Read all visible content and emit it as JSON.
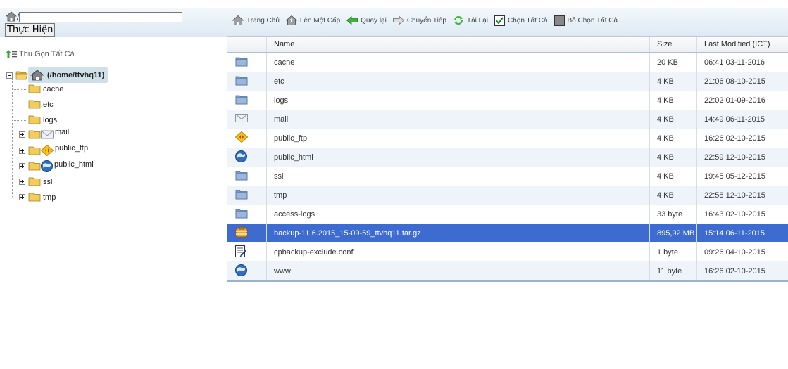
{
  "path_bar": {
    "prefix": "/",
    "value": ""
  },
  "go_button": "Thực Hiện",
  "collapse_all": "Thu Gọn Tất Cả",
  "tree": {
    "root": "(/home/ttvhq11)",
    "children": [
      {
        "label": "cache",
        "expander": "none",
        "icon": "folder-icon"
      },
      {
        "label": "etc",
        "expander": "none",
        "icon": "folder-icon"
      },
      {
        "label": "logs",
        "expander": "none",
        "icon": "folder-icon"
      },
      {
        "label": "mail",
        "expander": "plus",
        "icon": "mail-icon"
      },
      {
        "label": "public_ftp",
        "expander": "plus",
        "icon": "ftp-icon"
      },
      {
        "label": "public_html",
        "expander": "plus",
        "icon": "globe-icon"
      },
      {
        "label": "ssl",
        "expander": "plus",
        "icon": "folder-icon"
      },
      {
        "label": "tmp",
        "expander": "plus",
        "icon": "folder-icon"
      }
    ]
  },
  "toolbar": {
    "home": "Trang Chủ",
    "up": "Lên Một Cấp",
    "back": "Quay lại",
    "forward": "Chuyển Tiếp",
    "reload": "Tải Lại",
    "select_all": "Chọn Tất Cả",
    "deselect_all": "Bỏ Chọn Tất Cả"
  },
  "table": {
    "headers": {
      "icon": "",
      "name": "Name",
      "size": "Size",
      "modified": "Last Modified (ICT)"
    },
    "rows": [
      {
        "icon": "folder-icon",
        "name": "cache",
        "size": "20 KB",
        "modified": "06:41 03-11-2016"
      },
      {
        "icon": "folder-icon",
        "name": "etc",
        "size": "4 KB",
        "modified": "21:06 08-10-2015"
      },
      {
        "icon": "folder-icon",
        "name": "logs",
        "size": "4 KB",
        "modified": "22:02 01-09-2016"
      },
      {
        "icon": "mail-icon",
        "name": "mail",
        "size": "4 KB",
        "modified": "14:49 06-11-2015"
      },
      {
        "icon": "ftp-icon",
        "name": "public_ftp",
        "size": "4 KB",
        "modified": "16:26 02-10-2015"
      },
      {
        "icon": "globe-icon",
        "name": "public_html",
        "size": "4 KB",
        "modified": "22:59 12-10-2015"
      },
      {
        "icon": "folder-icon",
        "name": "ssl",
        "size": "4 KB",
        "modified": "19:45 05-12-2015"
      },
      {
        "icon": "folder-icon",
        "name": "tmp",
        "size": "4 KB",
        "modified": "22:58 12-10-2015"
      },
      {
        "icon": "folder-icon",
        "name": "access-logs",
        "size": "33 byte",
        "modified": "16:43 02-10-2015"
      },
      {
        "icon": "archive-icon",
        "name": "backup-11.6.2015_15-09-59_ttvhq11.tar.gz",
        "size": "895,92 MB",
        "modified": "15:14 06-11-2015",
        "selected": true
      },
      {
        "icon": "text-file-icon",
        "name": "cpbackup-exclude.conf",
        "size": "1 byte",
        "modified": "09:26 04-10-2015"
      },
      {
        "icon": "globe-icon",
        "name": "www",
        "size": "11 byte",
        "modified": "16:26 02-10-2015"
      }
    ]
  },
  "colors": {
    "selected_row": "#3d6bd0",
    "alt_row": "#eef4fa",
    "tree_root_bg": "#cfe0e8"
  }
}
